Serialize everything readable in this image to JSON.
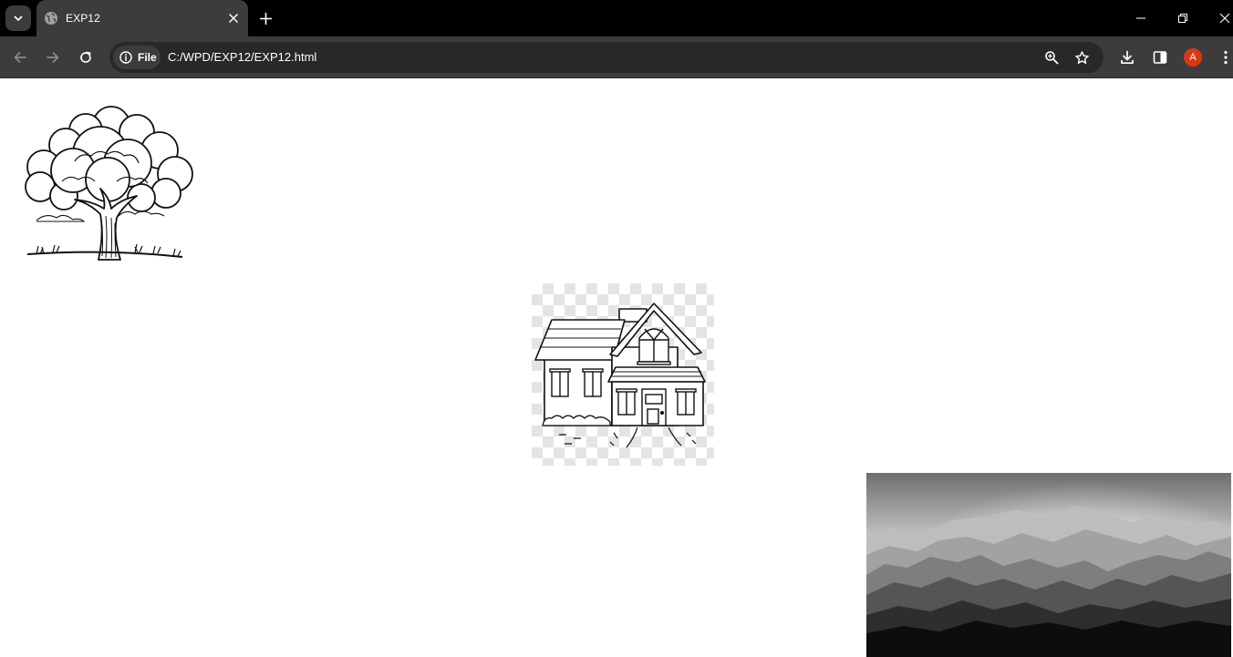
{
  "browser": {
    "tab": {
      "title": "EXP12",
      "favicon": "globe-icon"
    },
    "toolbar": {
      "chip_label": "File",
      "url": "C:/WPD/EXP12/EXP12.html",
      "profile_initial": "A"
    },
    "colors": {
      "tab_strip": "#000000",
      "toolbar": "#3c3c3c",
      "omnibox": "#282828",
      "avatar": "#d93a12"
    }
  },
  "page": {
    "images": [
      {
        "name": "tree-image",
        "depicts": "line-drawing of a tree"
      },
      {
        "name": "house-image",
        "depicts": "line-drawing of a house on a transparent checkerboard"
      },
      {
        "name": "mountains-image",
        "depicts": "grayscale mountain ranges photo"
      }
    ]
  }
}
